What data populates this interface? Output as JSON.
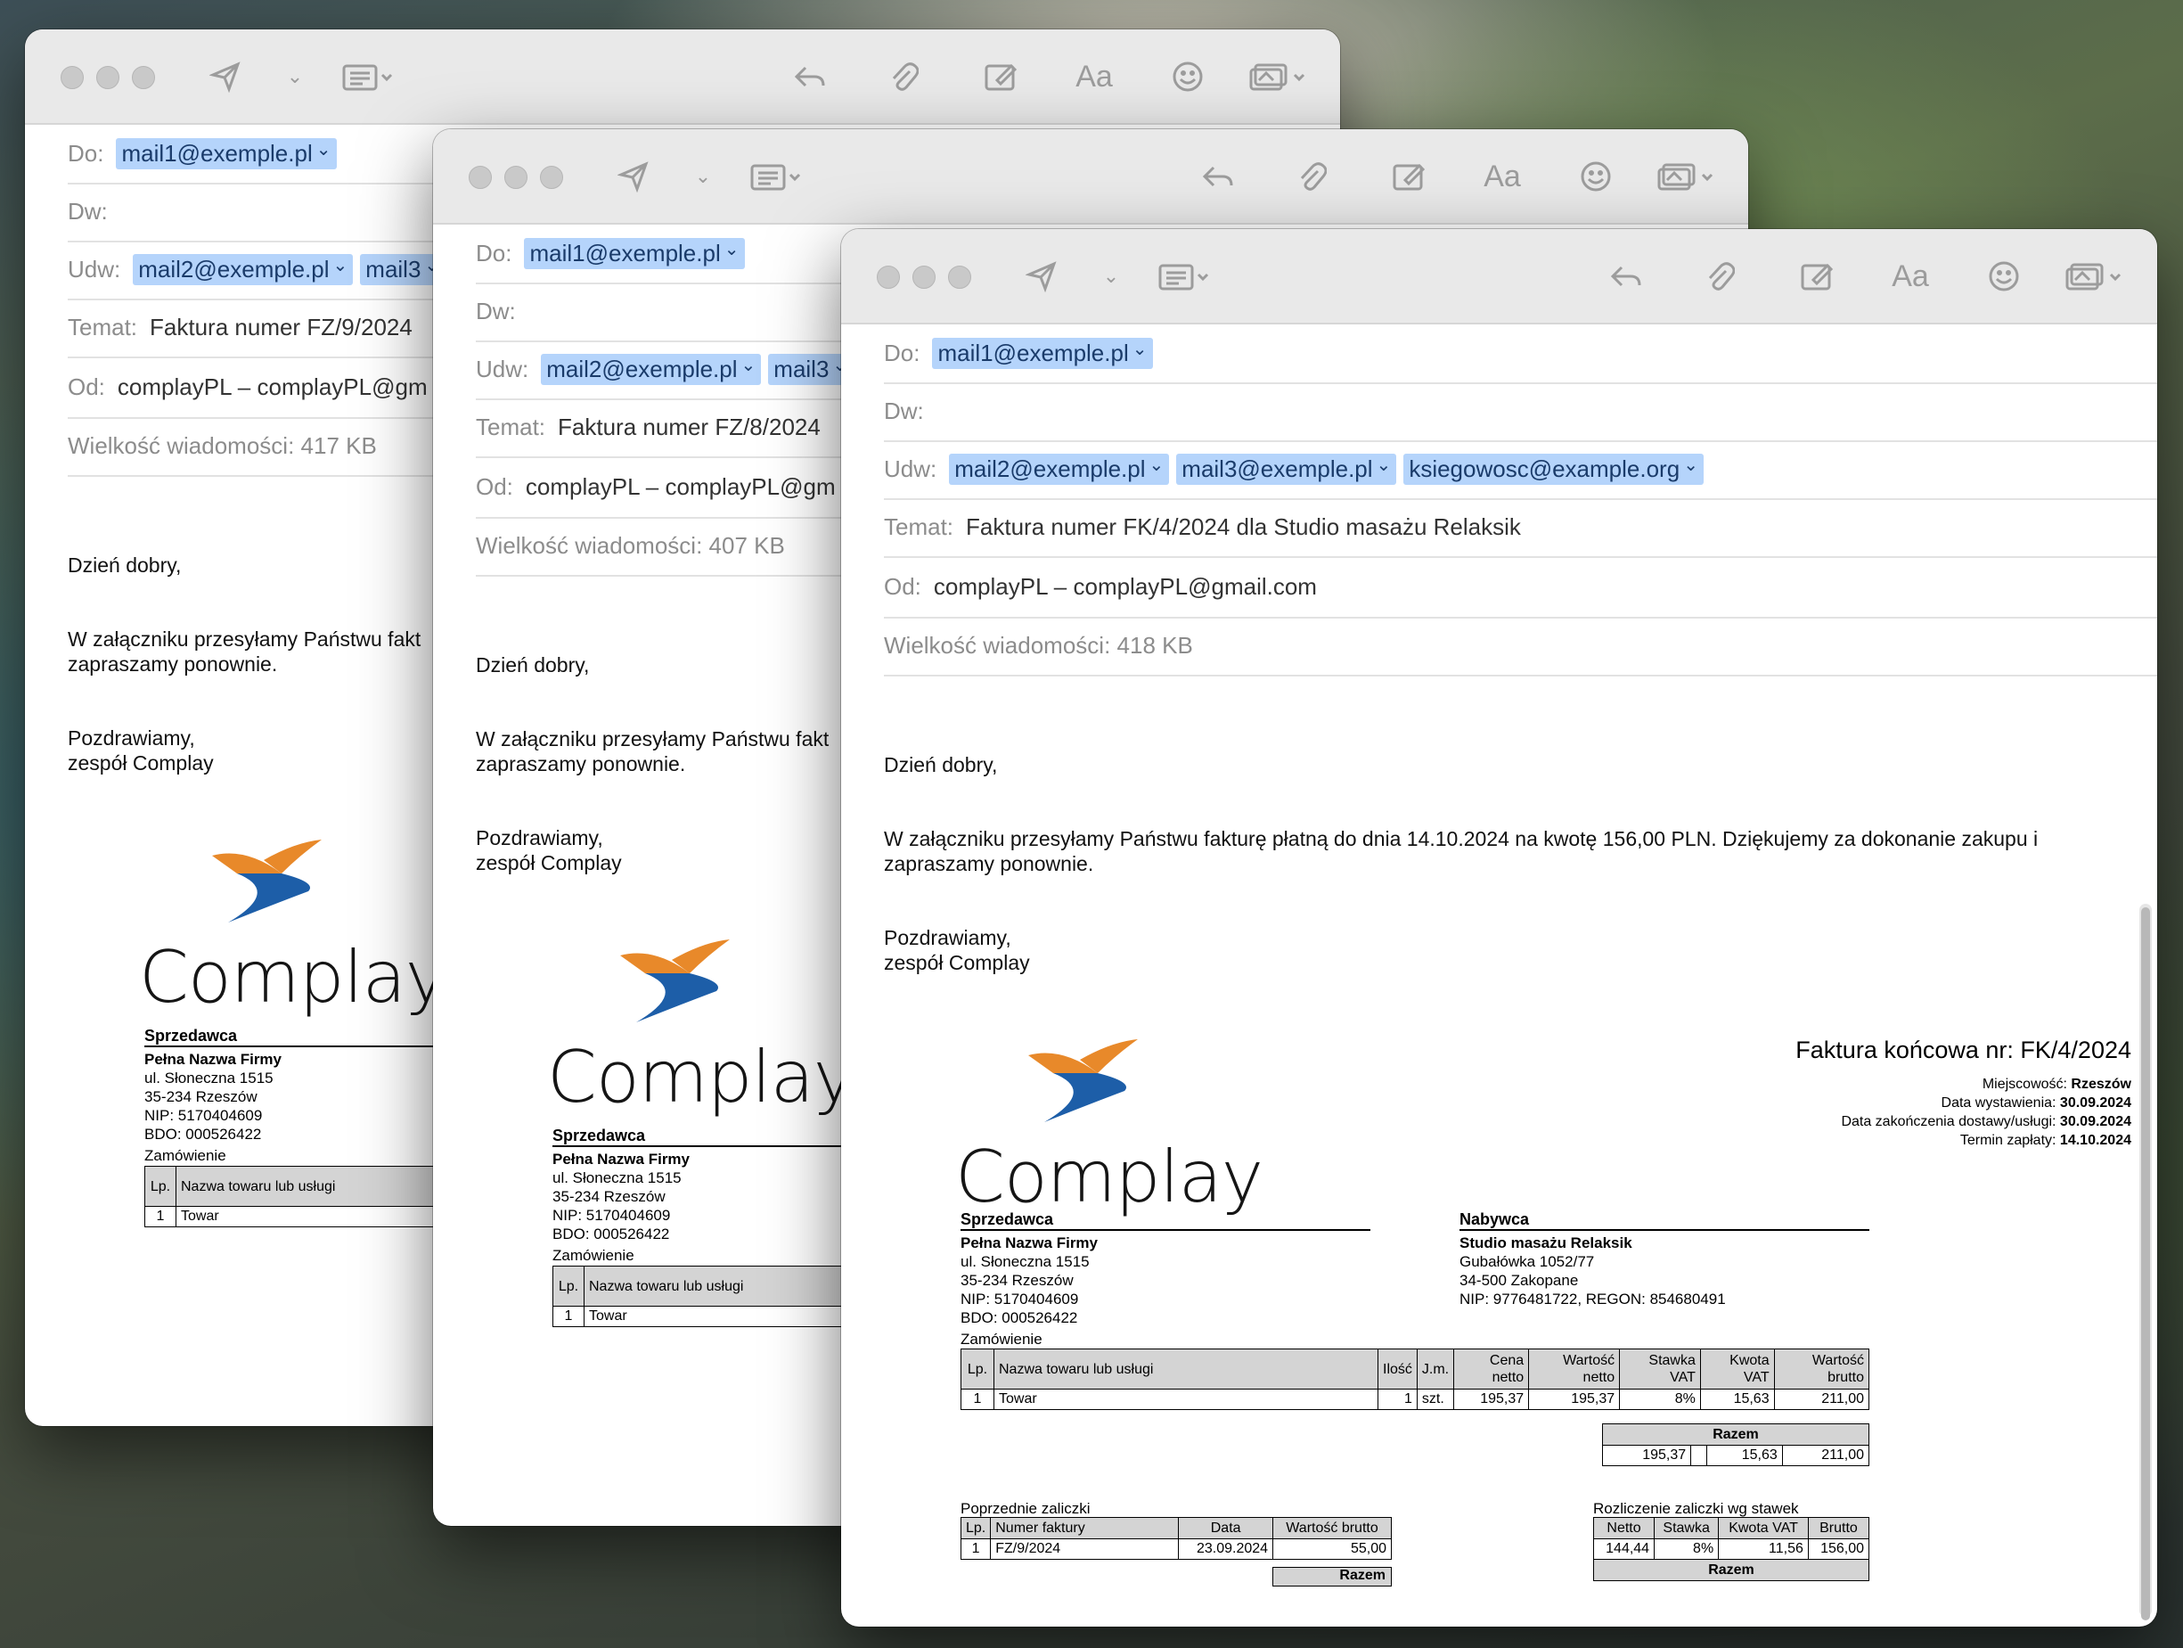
{
  "toolbar": {
    "font_label": "Aa"
  },
  "colors": {
    "chip_bg": "#b5d4fb",
    "toolbar_bg": "#e9e9e9"
  },
  "labels": {
    "to": "Do:",
    "cc": "Dw:",
    "bcc": "Udw:",
    "subject": "Temat:",
    "from": "Od:",
    "size": "Wielkość wiadomości:"
  },
  "windows": [
    {
      "to": "mail1@exemple.pl",
      "bcc": [
        "mail2@exemple.pl",
        "mail3"
      ],
      "subject": "Faktura numer FZ/9/2024",
      "from": "complayPL – complayPL@gm",
      "size": "417 KB",
      "greeting": "Dzień dobry,",
      "para1": "W załączniku przesyłamy Państwu fakt",
      "para1b": "zapraszamy ponownie.",
      "closing1": "Pozdrawiamy,",
      "closing2": "zespół Complay"
    },
    {
      "to": "mail1@exemple.pl",
      "bcc": [
        "mail2@exemple.pl",
        "mail3"
      ],
      "subject": "Faktura numer FZ/8/2024",
      "from": "complayPL – complayPL@gm",
      "size": "407 KB",
      "greeting": "Dzień dobry,",
      "para1": "W załączniku przesyłamy Państwu fakt",
      "para1b": "zapraszamy ponownie.",
      "closing1": "Pozdrawiamy,",
      "closing2": "zespół Complay"
    },
    {
      "to": "mail1@exemple.pl",
      "bcc": [
        "mail2@exemple.pl",
        "mail3@exemple.pl",
        "ksiegowosc@example.org"
      ],
      "subject": "Faktura numer FK/4/2024 dla Studio masażu Relaksik",
      "from": "complayPL – complayPL@gmail.com",
      "size": "418 KB",
      "greeting": "Dzień dobry,",
      "para1": "W załączniku przesyłamy Państwu fakturę płatną do dnia 14.10.2024 na kwotę 156,00 PLN. Dziękujemy za dokonanie zakupu i",
      "para1b": "zapraszamy ponownie.",
      "closing1": "Pozdrawiamy,",
      "closing2": "zespół Complay"
    }
  ],
  "invoice": {
    "brand": "Complay",
    "title": "Faktura końcowa nr: FK/4/2024",
    "place_label": "Miejscowość:",
    "place": "Rzeszów",
    "issue_label": "Data wystawienia:",
    "issue": "30.09.2024",
    "delivery_label": "Data zakończenia dostawy/usługi:",
    "delivery": "30.09.2024",
    "due_label": "Termin zapłaty:",
    "due": "14.10.2024",
    "seller_title": "Sprzedawca",
    "seller_name": "Pełna Nazwa Firmy",
    "seller_street": "ul. Słoneczna 1515",
    "seller_city": "35-234 Rzeszów",
    "seller_nip": "NIP: 5170404609",
    "seller_bdo": "BDO: 000526422",
    "buyer_title": "Nabywca",
    "buyer_name": "Studio masażu Relaksik",
    "buyer_street": "Gubałówka 1052/77",
    "buyer_city": "34-500 Zakopane",
    "buyer_ids": "NIP: 9776481722, REGON: 854680491",
    "order_title": "Zamówienie",
    "order_headers": [
      "Lp.",
      "Nazwa towaru lub usługi",
      "Ilość",
      "J.m.",
      "Cena netto",
      "Wartość netto",
      "Stawka VAT",
      "Kwota VAT",
      "Wartość brutto"
    ],
    "order_row": [
      "1",
      "Towar",
      "1",
      "szt.",
      "195,37",
      "195,37",
      "8%",
      "15,63",
      "211,00"
    ],
    "razem_label": "Razem",
    "razem_row": [
      "195,37",
      "",
      "15,63",
      "211,00"
    ],
    "prev_title": "Poprzednie zaliczki",
    "prev_headers": [
      "Lp.",
      "Numer faktury",
      "Data",
      "Wartość brutto"
    ],
    "prev_row": [
      "1",
      "FZ/9/2024",
      "23.09.2024",
      "55,00"
    ],
    "settle_title": "Rozliczenie zaliczki wg stawek",
    "settle_headers": [
      "Netto",
      "Stawka",
      "Kwota VAT",
      "Brutto"
    ],
    "settle_row": [
      "144,44",
      "8%",
      "11,56",
      "156,00"
    ]
  }
}
